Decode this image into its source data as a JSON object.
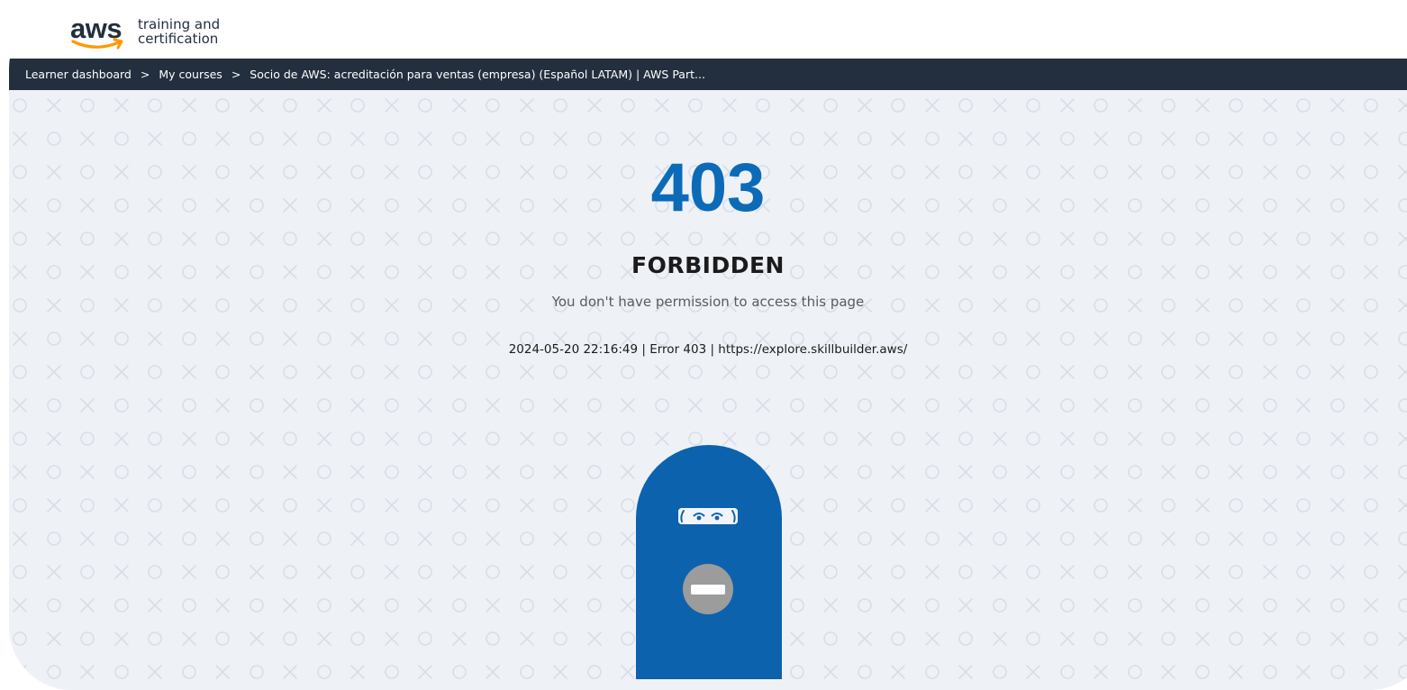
{
  "header": {
    "logo": {
      "mark": "aws",
      "line1": "training and",
      "line2": "certification",
      "smile_color": "#ff9900"
    }
  },
  "breadcrumb": {
    "items": [
      "Learner dashboard",
      "My courses",
      "Socio de AWS: acreditación para ventas (empresa) (Español LATAM) | AWS Part..."
    ],
    "separator": ">"
  },
  "error": {
    "code": "403",
    "title": "FORBIDDEN",
    "message": "You don't have permission to access this page",
    "details": "2024-05-20 22:16:49 | Error 403 | https://explore.skillbuilder.aws/"
  },
  "illustration": {
    "door_icon": "door-icon",
    "eyes_icon": "peeking-eyes-icon",
    "sign_icon": "no-entry-icon"
  },
  "colors": {
    "accent": "#0c6bb8",
    "nav_bg": "#232f3e",
    "page_bg": "#eef1f6",
    "pattern": "#d8dee8"
  }
}
